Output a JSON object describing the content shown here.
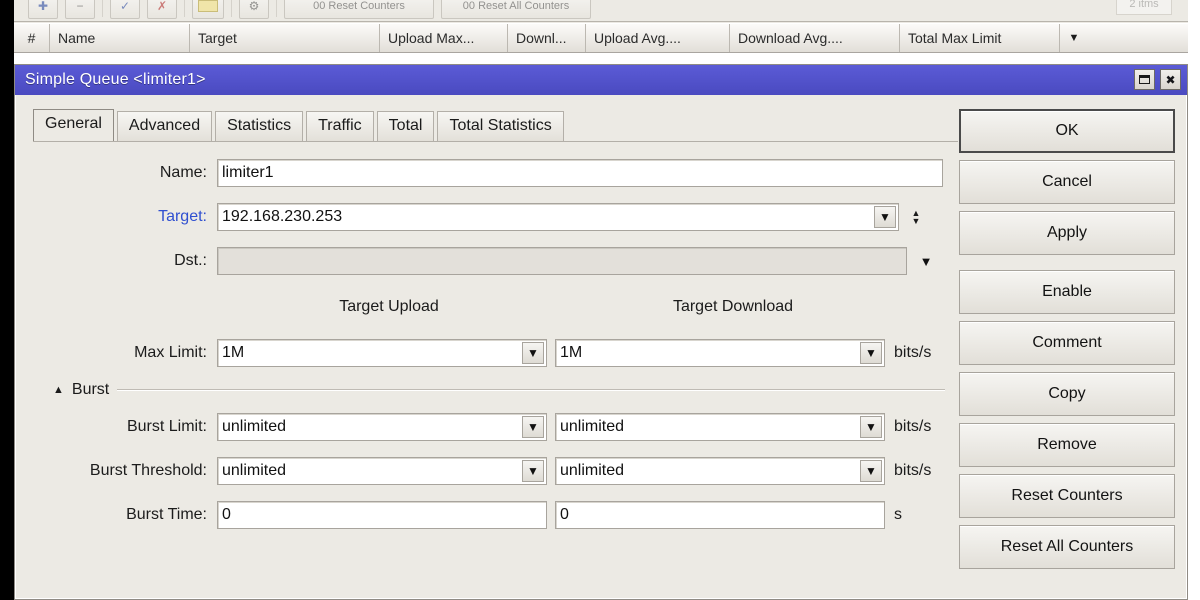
{
  "background": {
    "toolbar": {
      "buttons": [
        {
          "name": "add-button",
          "glyph": "+"
        },
        {
          "name": "remove-button",
          "glyph": "−"
        },
        {
          "name": "enable-button",
          "glyph": "✓"
        },
        {
          "name": "disable-button",
          "glyph": "✗"
        },
        {
          "name": "comment-button",
          "glyph": "▬"
        },
        {
          "name": "settings-button",
          "glyph": "⚙"
        },
        {
          "name": "reset-counters-button",
          "label": "00 Reset Counters"
        },
        {
          "name": "reset-all-counters-button",
          "label": "00 Reset All Counters"
        }
      ],
      "count": "2 itms"
    },
    "columns": [
      {
        "key": "num",
        "label": "#"
      },
      {
        "key": "name",
        "label": "Name"
      },
      {
        "key": "target",
        "label": "Target"
      },
      {
        "key": "upload_max",
        "label": "Upload Max..."
      },
      {
        "key": "download_max",
        "label": "Downl..."
      },
      {
        "key": "upload_avg",
        "label": "Upload Avg...."
      },
      {
        "key": "download_avg",
        "label": "Download Avg...."
      },
      {
        "key": "total_max",
        "label": "Total Max Limit"
      }
    ],
    "column_menu_icon": "▼"
  },
  "dialog": {
    "title": "Simple Queue <limiter1>",
    "window_buttons": {
      "restore_icon": "restore-icon",
      "close_label": "✖"
    },
    "tabs": [
      {
        "label": "General",
        "active": true
      },
      {
        "label": "Advanced",
        "active": false
      },
      {
        "label": "Statistics",
        "active": false
      },
      {
        "label": "Traffic",
        "active": false
      },
      {
        "label": "Total",
        "active": false
      },
      {
        "label": "Total Statistics",
        "active": false
      }
    ],
    "fields": {
      "name": {
        "label": "Name:",
        "value": "limiter1"
      },
      "target": {
        "label": "Target:",
        "value": "192.168.230.253",
        "dropdown_icon": "▼",
        "spinner_icon": "▲▼"
      },
      "dst": {
        "label": "Dst.:",
        "value": "",
        "dropdown_icon": "▼"
      }
    },
    "column_headers": {
      "upload": "Target Upload",
      "download": "Target Download"
    },
    "limits": [
      {
        "name": "max-limit",
        "label": "Max Limit:",
        "upload": "1M",
        "download": "1M",
        "unit": "bits/s",
        "dropdown_icon": "▼"
      }
    ],
    "burst": {
      "section_label": "Burst",
      "collapse_icon": "▲",
      "rows": [
        {
          "name": "burst-limit",
          "label": "Burst Limit:",
          "upload": "unlimited",
          "download": "unlimited",
          "unit": "bits/s",
          "dropdown_icon": "▼"
        },
        {
          "name": "burst-threshold",
          "label": "Burst Threshold:",
          "upload": "unlimited",
          "download": "unlimited",
          "unit": "bits/s",
          "dropdown_icon": "▼"
        },
        {
          "name": "burst-time",
          "label": "Burst Time:",
          "upload": "0",
          "download": "0",
          "unit": "s",
          "dropdown_icon": ""
        }
      ]
    },
    "buttons": [
      {
        "name": "ok-button",
        "label": "OK",
        "default": true
      },
      {
        "name": "cancel-button",
        "label": "Cancel",
        "default": false
      },
      {
        "name": "apply-button",
        "label": "Apply",
        "default": false
      },
      {
        "name": "enable-button",
        "label": "Enable",
        "default": false
      },
      {
        "name": "comment-button",
        "label": "Comment",
        "default": false
      },
      {
        "name": "copy-button",
        "label": "Copy",
        "default": false
      },
      {
        "name": "remove-button",
        "label": "Remove",
        "default": false
      },
      {
        "name": "reset-counters-button",
        "label": "Reset Counters",
        "default": false
      },
      {
        "name": "reset-all-counters-button",
        "label": "Reset All Counters",
        "default": false
      }
    ]
  },
  "colors": {
    "title_bar": "#4a4ac0",
    "window_bg": "#eceae4",
    "link_label": "#2f4fd0"
  }
}
